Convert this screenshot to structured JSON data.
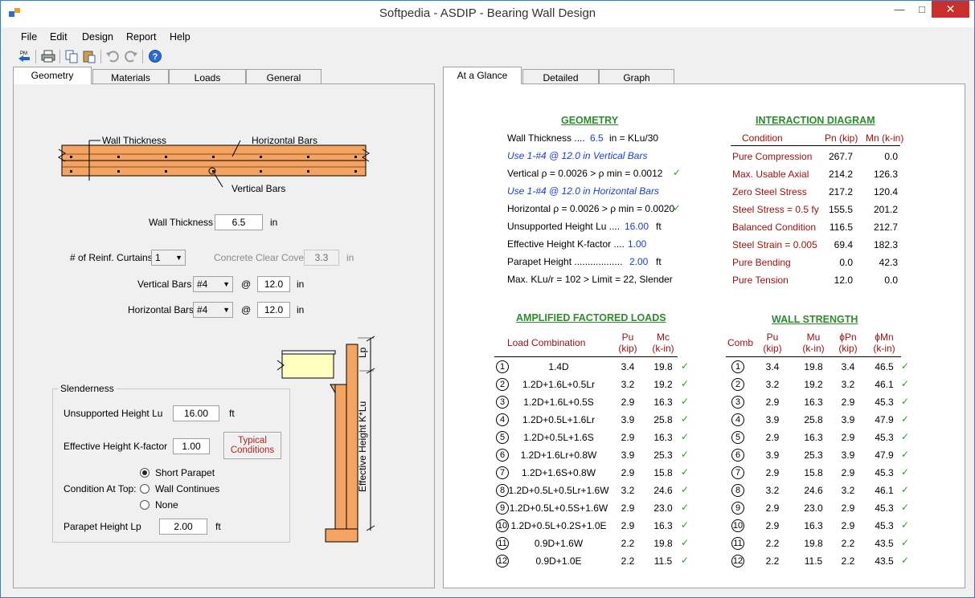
{
  "window": {
    "title": "Softpedia - ASDIP - Bearing Wall Design",
    "close": "✕",
    "minimize": "—",
    "maximize": "□"
  },
  "menu": [
    "File",
    "Edit",
    "Design",
    "Report",
    "Help"
  ],
  "toolbar": {
    "pm_label": "PM"
  },
  "left_tabs": [
    "Geometry",
    "Materials",
    "Loads",
    "General"
  ],
  "right_tabs": [
    "At a Glance",
    "Detailed",
    "Graph"
  ],
  "geometry": {
    "diagram": {
      "wall_thickness": "Wall Thickness",
      "horizontal_bars": "Horizontal Bars",
      "vertical_bars": "Vertical Bars",
      "lp": "Lp",
      "effective_height": "Effective Height K*Lu"
    },
    "wall_thickness": {
      "label": "Wall Thickness",
      "value": "6.5",
      "unit": "in"
    },
    "curtains": {
      "label": "# of Reinf. Curtains",
      "value": "1"
    },
    "clear_cover": {
      "label": "Concrete Clear Cover",
      "value": "3.3",
      "unit": "in"
    },
    "vertical_bars": {
      "label": "Vertical Bars",
      "size": "#4",
      "at": "@",
      "spacing": "12.0",
      "unit": "in"
    },
    "horizontal_bars": {
      "label": "Horizontal Bars",
      "size": "#4",
      "at": "@",
      "spacing": "12.0",
      "unit": "in"
    },
    "slenderness": {
      "legend": "Slenderness",
      "lu_label": "Unsupported Height  Lu",
      "lu_value": "16.00",
      "lu_unit": "ft",
      "k_label": "Effective Height K-factor",
      "k_value": "1.00",
      "typical_btn": "Typical Conditions",
      "top_label": "Condition At Top:",
      "options": [
        "Short Parapet",
        "Wall Continues",
        "None"
      ],
      "parapet_label": "Parapet Height  Lp",
      "parapet_value": "2.00",
      "parapet_unit": "ft"
    }
  },
  "glance": {
    "geometry": {
      "header": "GEOMETRY",
      "wall_thickness": {
        "label": "Wall Thickness  ....",
        "value": "6.5",
        "unit": "in   =  KLu/30"
      },
      "vert_note": "Use 1-#4 @ 12.0 in Vertical Bars",
      "vert_rho": "Vertical ρ = 0.0026   >   ρ min = 0.0012",
      "horiz_note": "Use 1-#4 @ 12.0 in Horizontal Bars",
      "horiz_rho": "Horizontal ρ = 0.0026  >   ρ min = 0.0020",
      "lu": {
        "label": "Unsupported Height  Lu   ....",
        "value": "16.00",
        "unit": "ft"
      },
      "k": {
        "label": "Effective Height K-factor   ....",
        "value": "1.00"
      },
      "parapet": {
        "label": "Parapet Height   ..................",
        "value": "2.00",
        "unit": "ft"
      },
      "klu": "Max. KLu/r  =  102   >  Limit = 22,   Slender",
      "check": "✓"
    },
    "interaction": {
      "header": "INTERACTION DIAGRAM",
      "cols": [
        "Condition",
        "Pn (kip)",
        "Mn (k-in)"
      ],
      "rows": [
        {
          "c": "Pure Compression",
          "pn": "267.7",
          "mn": "0.0"
        },
        {
          "c": "Max. Usable Axial",
          "pn": "214.2",
          "mn": "126.3"
        },
        {
          "c": "Zero Steel Stress",
          "pn": "217.2",
          "mn": "120.4"
        },
        {
          "c": "Steel Stress = 0.5 fy",
          "pn": "155.5",
          "mn": "201.2"
        },
        {
          "c": "Balanced Condition",
          "pn": "116.5",
          "mn": "212.7"
        },
        {
          "c": "Steel Strain = 0.005",
          "pn": "69.4",
          "mn": "182.3"
        },
        {
          "c": "Pure Bending",
          "pn": "0.0",
          "mn": "42.3"
        },
        {
          "c": "Pure Tension",
          "pn": "12.0",
          "mn": "0.0"
        }
      ]
    },
    "loads": {
      "header": "AMPLIFIED FACTORED LOADS",
      "col_combo": "Load Combination",
      "col_pu": [
        "Pu",
        "(kip)"
      ],
      "col_mc": [
        "Mc",
        "(k-in)"
      ],
      "rows": [
        {
          "n": "1",
          "combo": "1.4D",
          "pu": "3.4",
          "mc": "19.8"
        },
        {
          "n": "2",
          "combo": "1.2D+1.6L+0.5Lr",
          "pu": "3.2",
          "mc": "19.2"
        },
        {
          "n": "3",
          "combo": "1.2D+1.6L+0.5S",
          "pu": "2.9",
          "mc": "16.3"
        },
        {
          "n": "4",
          "combo": "1.2D+0.5L+1.6Lr",
          "pu": "3.9",
          "mc": "25.8"
        },
        {
          "n": "5",
          "combo": "1.2D+0.5L+1.6S",
          "pu": "2.9",
          "mc": "16.3"
        },
        {
          "n": "6",
          "combo": "1.2D+1.6Lr+0.8W",
          "pu": "3.9",
          "mc": "25.3"
        },
        {
          "n": "7",
          "combo": "1.2D+1.6S+0.8W",
          "pu": "2.9",
          "mc": "15.8"
        },
        {
          "n": "8",
          "combo": "1.2D+0.5L+0.5Lr+1.6W",
          "pu": "3.2",
          "mc": "24.6"
        },
        {
          "n": "9",
          "combo": "1.2D+0.5L+0.5S+1.6W",
          "pu": "2.9",
          "mc": "23.0"
        },
        {
          "n": "10",
          "combo": "1.2D+0.5L+0.2S+1.0E",
          "pu": "2.9",
          "mc": "16.3"
        },
        {
          "n": "11",
          "combo": "0.9D+1.6W",
          "pu": "2.2",
          "mc": "19.8"
        },
        {
          "n": "12",
          "combo": "0.9D+1.0E",
          "pu": "2.2",
          "mc": "11.5"
        }
      ]
    },
    "strength": {
      "header": "WALL STRENGTH",
      "col_comb": "Comb",
      "col_pu": [
        "Pu",
        "(kip)"
      ],
      "col_mu": [
        "Mu",
        "(k-in)"
      ],
      "col_phipn": [
        "ϕPn",
        "(kip)"
      ],
      "col_phimn": [
        "ϕMn",
        "(k-in)"
      ],
      "rows": [
        {
          "pu": "3.4",
          "mu": "19.8",
          "pn": "3.4",
          "mn": "46.5"
        },
        {
          "pu": "3.2",
          "mu": "19.2",
          "pn": "3.2",
          "mn": "46.1"
        },
        {
          "pu": "2.9",
          "mu": "16.3",
          "pn": "2.9",
          "mn": "45.3"
        },
        {
          "pu": "3.9",
          "mu": "25.8",
          "pn": "3.9",
          "mn": "47.9"
        },
        {
          "pu": "2.9",
          "mu": "16.3",
          "pn": "2.9",
          "mn": "45.3"
        },
        {
          "pu": "3.9",
          "mu": "25.3",
          "pn": "3.9",
          "mn": "47.9"
        },
        {
          "pu": "2.9",
          "mu": "15.8",
          "pn": "2.9",
          "mn": "45.3"
        },
        {
          "pu": "3.2",
          "mu": "24.6",
          "pn": "3.2",
          "mn": "46.1"
        },
        {
          "pu": "2.9",
          "mu": "23.0",
          "pn": "2.9",
          "mn": "45.3"
        },
        {
          "pu": "2.9",
          "mu": "16.3",
          "pn": "2.9",
          "mn": "45.3"
        },
        {
          "pu": "2.2",
          "mu": "19.8",
          "pn": "2.2",
          "mn": "43.5"
        },
        {
          "pu": "2.2",
          "mu": "11.5",
          "pn": "2.2",
          "mn": "43.5"
        }
      ]
    }
  }
}
